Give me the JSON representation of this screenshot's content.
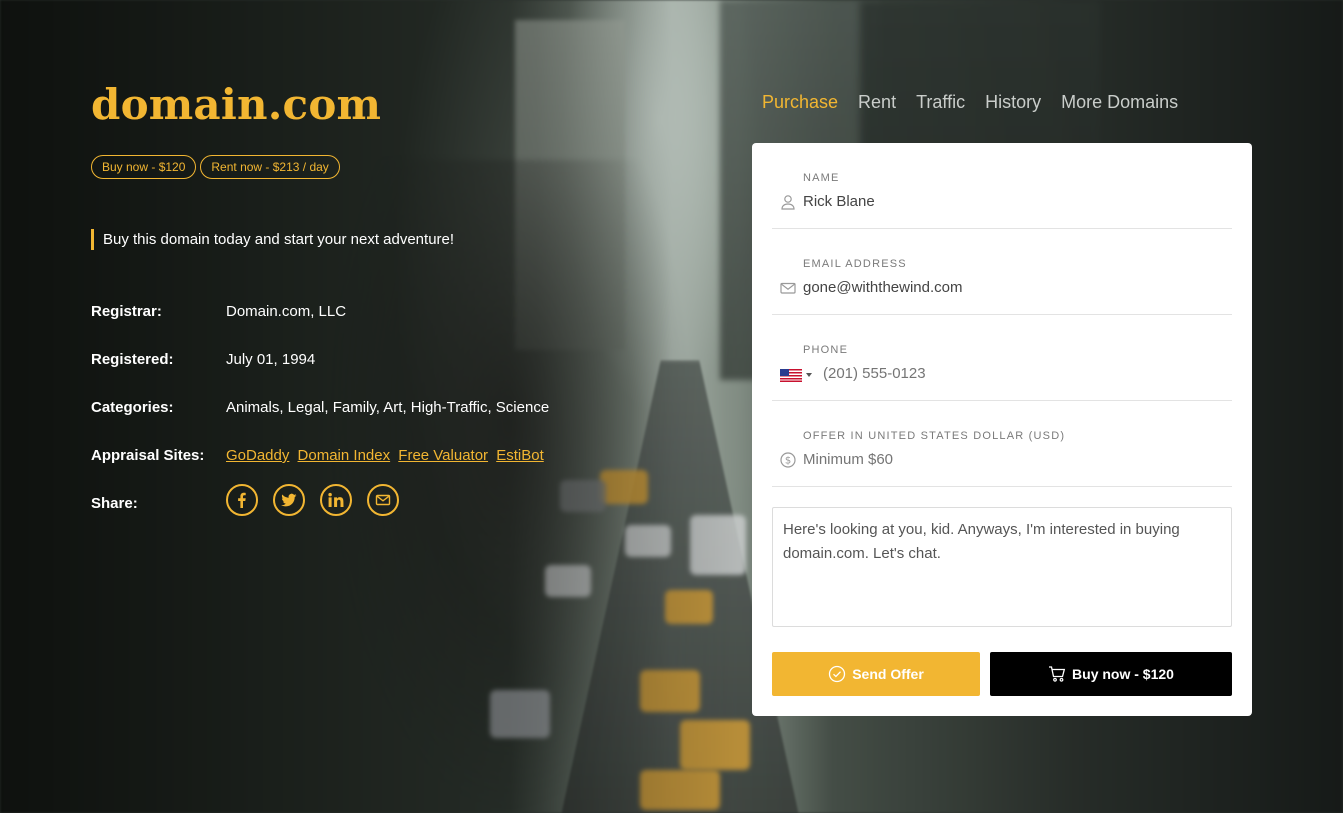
{
  "brand": {
    "name": "domain.com"
  },
  "pills": {
    "buy": "Buy now - $120",
    "rent": "Rent now - $213 / day"
  },
  "tagline": "Buy this domain today and start your next adventure!",
  "details": {
    "registrar_label": "Registrar:",
    "registrar_value": "Domain.com, LLC",
    "registered_label": "Registered:",
    "registered_value": "July 01, 1994",
    "categories_label": "Categories:",
    "categories_value": "Animals, Legal, Family, Art, High-Traffic, Science",
    "appraisal_label": "Appraisal Sites:",
    "appraisal_links": [
      "GoDaddy",
      "Domain Index",
      "Free Valuator",
      "EstiBot"
    ],
    "share_label": "Share:",
    "share_icons": [
      "facebook-icon",
      "twitter-icon",
      "linkedin-icon",
      "email-icon"
    ]
  },
  "nav": [
    "Purchase",
    "Rent",
    "Traffic",
    "History",
    "More Domains"
  ],
  "form": {
    "name_label": "Name",
    "name_value": "Rick Blane",
    "email_label": "Email Address",
    "email_value": "gone@withthewind.com",
    "phone_label": "Phone",
    "phone_placeholder": "(201) 555-0123",
    "offer_label": "Offer in United States Dollar (USD)",
    "offer_placeholder": "Minimum $60",
    "message": "Here's looking at you, kid. Anyways, I'm interested in buying domain.com. Let's chat.",
    "send_label": "Send Offer",
    "buy_label": "Buy now - $120"
  },
  "colors": {
    "accent": "#f2b632",
    "buy_button": "#000000",
    "card": "#ffffff"
  }
}
